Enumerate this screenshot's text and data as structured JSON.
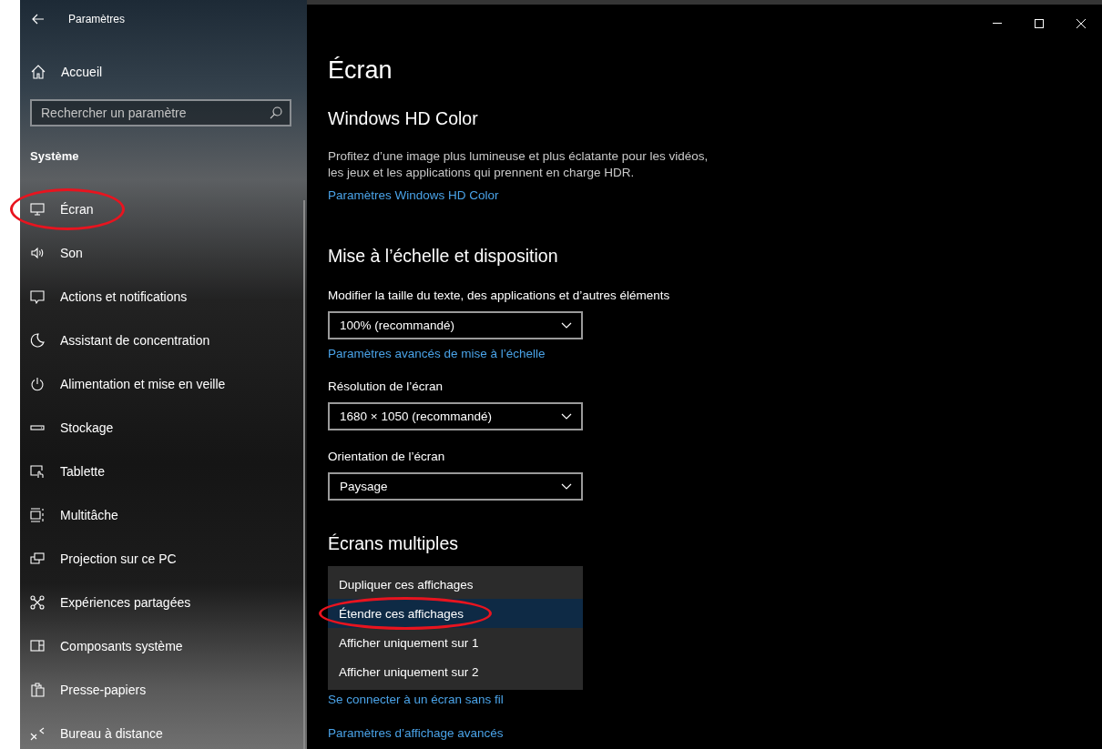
{
  "window": {
    "title": "Paramètres"
  },
  "sidebar": {
    "home": "Accueil",
    "search": {
      "placeholder": "Rechercher un paramètre"
    },
    "section": "Système",
    "items": [
      {
        "label": "Écran",
        "circled": true
      },
      {
        "label": "Son",
        "circled": false
      },
      {
        "label": "Actions et notifications",
        "circled": false
      },
      {
        "label": "Assistant de concentration",
        "circled": false
      },
      {
        "label": "Alimentation et mise en veille",
        "circled": false
      },
      {
        "label": "Stockage",
        "circled": false
      },
      {
        "label": "Tablette",
        "circled": false
      },
      {
        "label": "Multitâche",
        "circled": false
      },
      {
        "label": "Projection sur ce PC",
        "circled": false
      },
      {
        "label": "Expériences partagées",
        "circled": false
      },
      {
        "label": "Composants système",
        "circled": false
      },
      {
        "label": "Presse-papiers",
        "circled": false
      },
      {
        "label": "Bureau à distance",
        "circled": false
      }
    ]
  },
  "page": {
    "title": "Écran",
    "sections": [
      {
        "heading": "Windows HD Color",
        "blocks": [
          {
            "kind": "text",
            "text": "Profitez d’une image plus lumineuse et plus éclatante pour les vidéos, les jeux et les applications qui prennent en charge HDR."
          },
          {
            "kind": "link",
            "text": "Paramètres Windows HD Color"
          }
        ]
      },
      {
        "heading": "Mise à l’échelle et disposition",
        "blocks": [
          {
            "kind": "label",
            "text": "Modifier la taille du texte, des applications et d’autres éléments"
          },
          {
            "kind": "select",
            "value": "100% (recommandé)"
          },
          {
            "kind": "link",
            "text": "Paramètres avancés de mise à l’échelle"
          },
          {
            "kind": "label",
            "text": "Résolution de l’écran"
          },
          {
            "kind": "select",
            "value": "1680 × 1050 (recommandé)"
          },
          {
            "kind": "label",
            "text": "Orientation de l’écran"
          },
          {
            "kind": "select",
            "value": "Paysage"
          }
        ]
      },
      {
        "heading": "Écrans multiples",
        "blocks": [
          {
            "kind": "menu",
            "options": [
              {
                "label": "Dupliquer ces affichages",
                "selected": false,
                "circled": false
              },
              {
                "label": "Étendre ces affichages",
                "selected": true,
                "circled": true
              },
              {
                "label": "Afficher uniquement sur 1",
                "selected": false,
                "circled": false
              },
              {
                "label": "Afficher uniquement sur 2",
                "selected": false,
                "circled": false
              }
            ]
          },
          {
            "kind": "link",
            "text": "Se connecter à un écran sans fil"
          },
          {
            "kind": "link",
            "text": "Paramètres d’affichage avancés"
          }
        ]
      }
    ]
  }
}
